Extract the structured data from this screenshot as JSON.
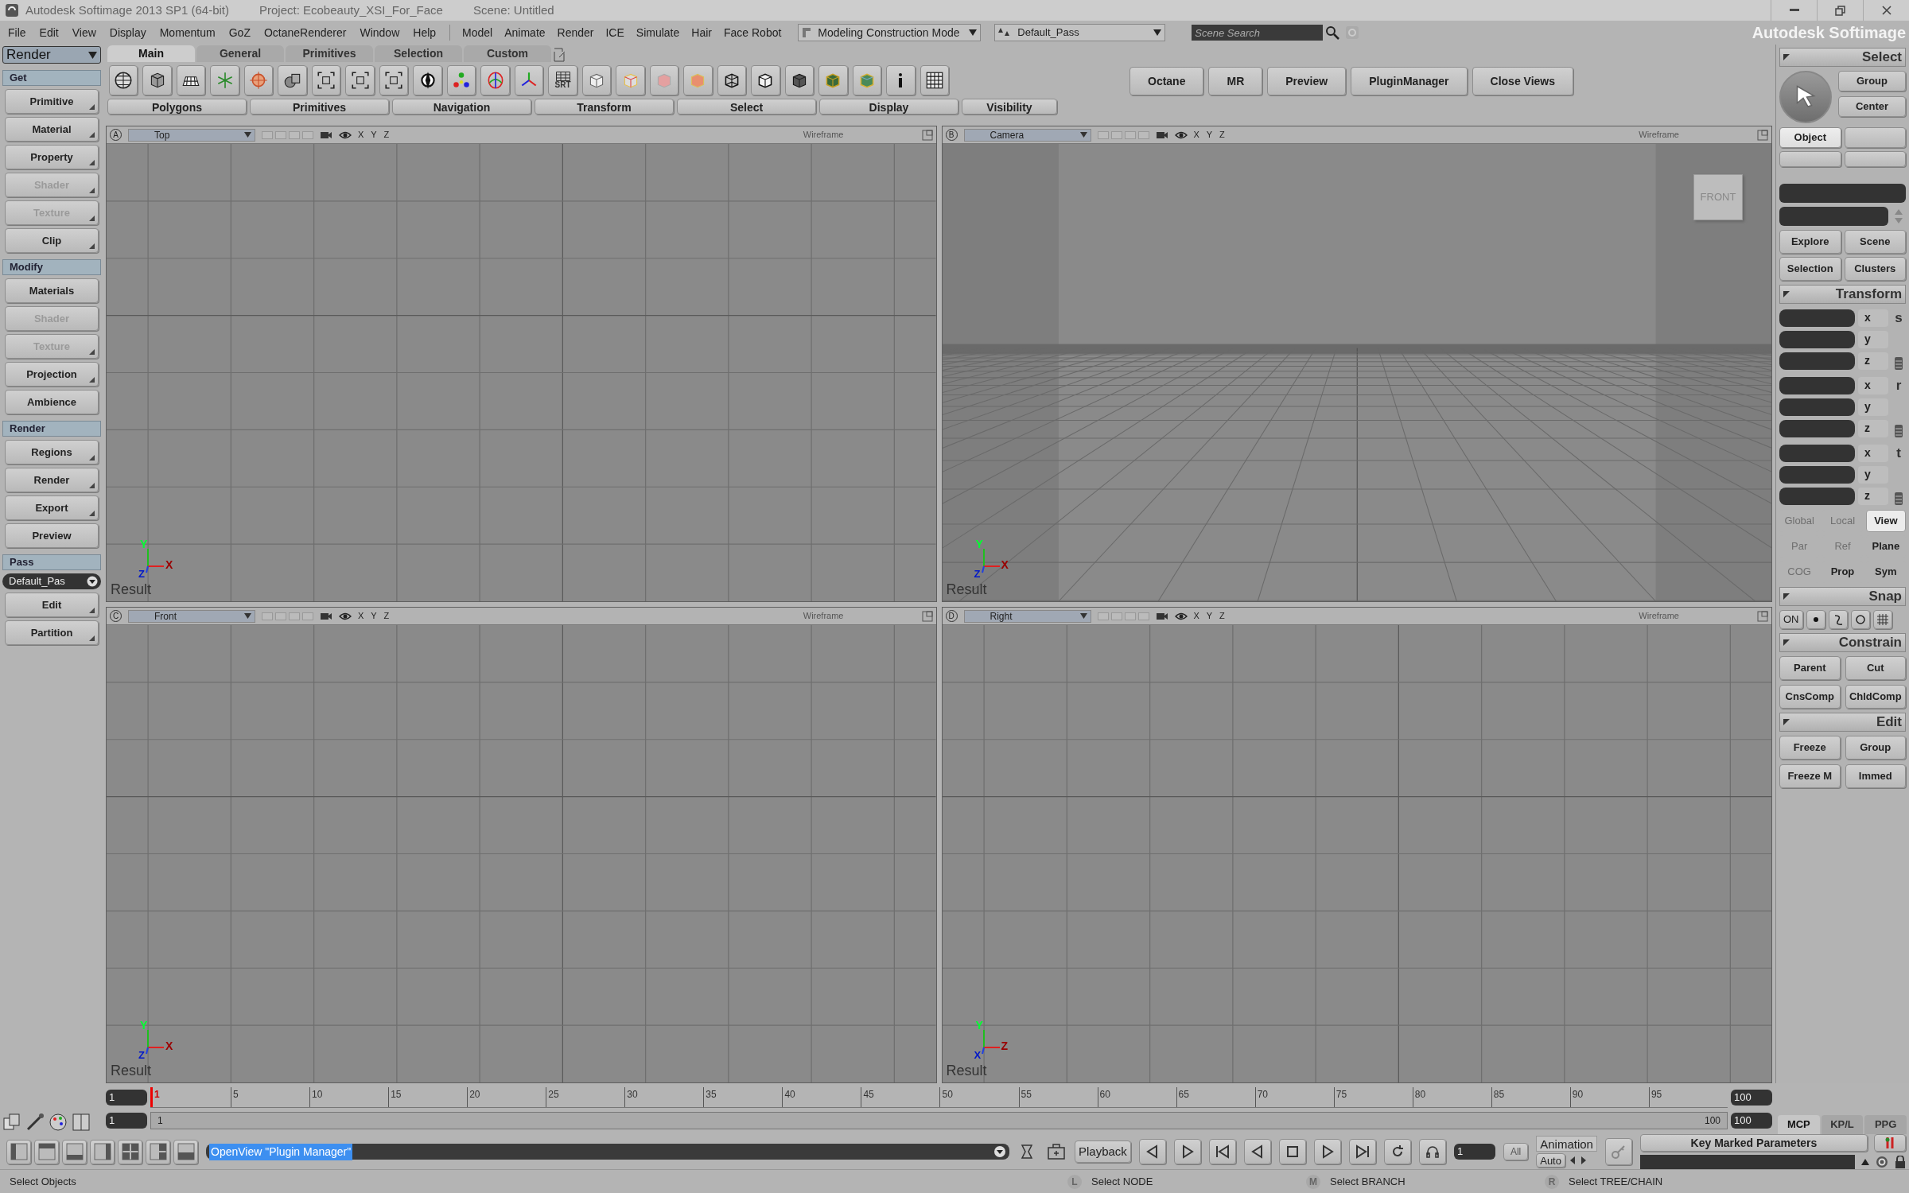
{
  "window": {
    "title": "Autodesk Softimage 2013 SP1 (64-bit)",
    "project": "Project: Ecobeauty_XSI_For_Face",
    "scene": "Scene: Untitled",
    "brand": "Autodesk Softimage"
  },
  "menu": [
    "File",
    "Edit",
    "View",
    "Display",
    "Momentum",
    "GoZ",
    "OctaneRenderer",
    "Window",
    "Help"
  ],
  "menu_modules": [
    "Model",
    "Animate",
    "Render",
    "ICE",
    "Simulate",
    "Hair",
    "Face Robot"
  ],
  "mode_dropdown": "Modeling Construction Mode",
  "pass_dropdown": "Default_Pass",
  "scene_search": {
    "placeholder": "Scene Search"
  },
  "module_dropdown": "Render",
  "toolbar_tabs": [
    {
      "label": "Main",
      "selected": true
    },
    {
      "label": "General",
      "selected": false
    },
    {
      "label": "Primitives",
      "selected": false
    },
    {
      "label": "Selection",
      "selected": false
    },
    {
      "label": "Custom",
      "selected": false
    }
  ],
  "srt_label": "SRT",
  "toolbar_groups": [
    "Polygons",
    "Primitives",
    "Navigation",
    "Transform",
    "Select",
    "Display",
    "Visibility"
  ],
  "quick_buttons": [
    "Octane",
    "MR",
    "Preview",
    "PluginManager",
    "Close Views"
  ],
  "left_panel": [
    {
      "title": "Get",
      "items": [
        {
          "label": "Primitive",
          "disabled": false,
          "submenu": true
        },
        {
          "label": "Material",
          "disabled": false,
          "submenu": true
        },
        {
          "label": "Property",
          "disabled": false,
          "submenu": true
        },
        {
          "label": "Shader",
          "disabled": true,
          "submenu": true
        },
        {
          "label": "Texture",
          "disabled": true,
          "submenu": true
        },
        {
          "label": "Clip",
          "disabled": false,
          "submenu": true
        }
      ]
    },
    {
      "title": "Modify",
      "items": [
        {
          "label": "Materials",
          "disabled": false,
          "submenu": false
        },
        {
          "label": "Shader",
          "disabled": true,
          "submenu": false
        },
        {
          "label": "Texture",
          "disabled": true,
          "submenu": true
        },
        {
          "label": "Projection",
          "disabled": false,
          "submenu": true
        },
        {
          "label": "Ambience",
          "disabled": false,
          "submenu": false
        }
      ]
    },
    {
      "title": "Render",
      "items": [
        {
          "label": "Regions",
          "disabled": false,
          "submenu": true
        },
        {
          "label": "Render",
          "disabled": false,
          "submenu": true
        },
        {
          "label": "Export",
          "disabled": false,
          "submenu": true
        },
        {
          "label": "Preview",
          "disabled": false,
          "submenu": false
        }
      ]
    },
    {
      "title": "Pass",
      "dropdown": "Default_Pas",
      "items": [
        {
          "label": "Edit",
          "disabled": false,
          "submenu": true
        },
        {
          "label": "Partition",
          "disabled": false,
          "submenu": true
        }
      ]
    }
  ],
  "viewports": [
    {
      "letter": "A",
      "name": "Top",
      "kind": "ortho",
      "axes": "X Y Z",
      "mode": "Wireframe",
      "result": "Result",
      "gizmo": [
        "Y",
        "X",
        "Z"
      ]
    },
    {
      "letter": "B",
      "name": "Camera",
      "kind": "perspective",
      "axes": "X Y Z",
      "mode": "Wireframe",
      "result": "Result",
      "gizmo": [
        "Y",
        "X",
        "Z"
      ],
      "view_cube": "FRONT"
    },
    {
      "letter": "C",
      "name": "Front",
      "kind": "ortho",
      "axes": "X Y Z",
      "mode": "Wireframe",
      "result": "Result",
      "gizmo": [
        "Y",
        "X",
        "Z"
      ]
    },
    {
      "letter": "D",
      "name": "Right",
      "kind": "ortho",
      "axes": "X Y Z",
      "mode": "Wireframe",
      "result": "Result",
      "gizmo": [
        "Y",
        "Z",
        "X"
      ]
    }
  ],
  "right_panel": {
    "select": {
      "title": "Select",
      "buttons": [
        {
          "label": "Group",
          "selected": false
        },
        {
          "label": "Center",
          "selected": false
        },
        {
          "label": "Object",
          "selected": true
        }
      ],
      "explore": [
        "Explore",
        "Scene",
        "Selection",
        "Clusters"
      ]
    },
    "transform": {
      "title": "Transform",
      "rows": [
        {
          "symbol": "s",
          "axes": [
            "x",
            "y",
            "z"
          ]
        },
        {
          "symbol": "r",
          "axes": [
            "x",
            "y",
            "z"
          ]
        },
        {
          "symbol": "t",
          "axes": [
            "x",
            "y",
            "z"
          ]
        }
      ],
      "options": [
        {
          "label": "Global",
          "selected": false,
          "disabled": true
        },
        {
          "label": "Local",
          "selected": false,
          "disabled": true
        },
        {
          "label": "View",
          "selected": true,
          "disabled": false
        },
        {
          "label": "Par",
          "selected": false,
          "disabled": true
        },
        {
          "label": "Ref",
          "selected": false,
          "disabled": true
        },
        {
          "label": "Plane",
          "selected": false,
          "disabled": false
        },
        {
          "label": "COG",
          "selected": false,
          "disabled": true
        },
        {
          "label": "Prop",
          "selected": false,
          "disabled": false
        },
        {
          "label": "Sym",
          "selected": false,
          "disabled": false
        }
      ]
    },
    "snap": {
      "title": "Snap",
      "on": "ON"
    },
    "constrain": {
      "title": "Constrain",
      "buttons": [
        "Parent",
        "Cut",
        "CnsComp",
        "ChldComp"
      ]
    },
    "edit": {
      "title": "Edit",
      "buttons": [
        "Freeze",
        "Group",
        "Freeze M",
        "Immed"
      ]
    }
  },
  "timeline": {
    "start": "1",
    "current": "1",
    "ticks": [
      "5",
      "10",
      "15",
      "20",
      "25",
      "30",
      "35",
      "40",
      "45",
      "50",
      "55",
      "60",
      "65",
      "70",
      "75",
      "80",
      "85",
      "90",
      "95"
    ],
    "end": "100",
    "range_start": "1",
    "range_label_start": "1",
    "range_label_end": "100",
    "range_end": "100"
  },
  "panel_tabs": [
    {
      "label": "MCP",
      "selected": true
    },
    {
      "label": "KP/L",
      "selected": false
    },
    {
      "label": "PPG",
      "selected": false
    }
  ],
  "command_line": "OpenView \"Plugin Manager\"",
  "playback": {
    "label": "Playback",
    "frame": "1",
    "all": "All",
    "animation": "Animation",
    "auto": "Auto",
    "key_marked": "Key Marked Parameters"
  },
  "status": {
    "message": "Select Objects",
    "hints": [
      {
        "key": "L",
        "text": "Select NODE"
      },
      {
        "key": "M",
        "text": "Select BRANCH"
      },
      {
        "key": "R",
        "text": "Select TREE/CHAIN"
      }
    ]
  }
}
